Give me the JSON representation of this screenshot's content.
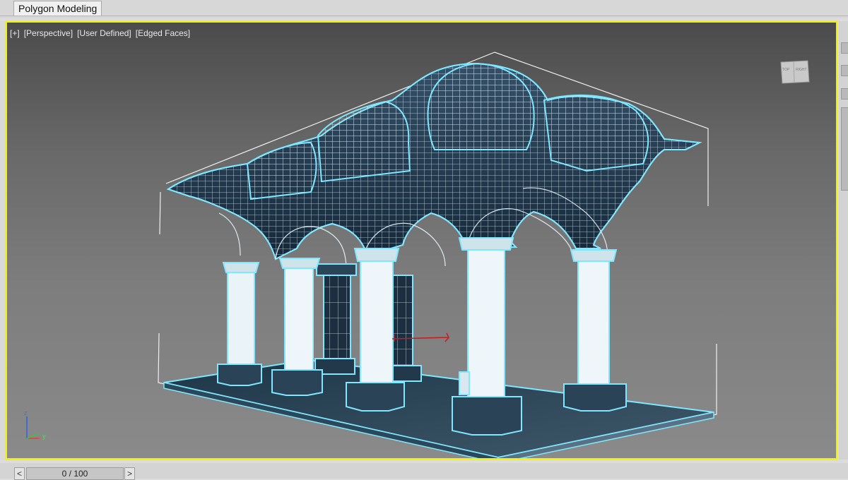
{
  "ribbon": {
    "tab_label": "Polygon Modeling"
  },
  "viewport": {
    "labels": [
      "[+]",
      "[Perspective]",
      "[User Defined]",
      "[Edged Faces]"
    ],
    "active_border_color": "#f2f200",
    "wire_color": "#7fe7ff",
    "viewcube_faces": [
      "TOP",
      "RIGHT"
    ],
    "axis_labels": {
      "z": "z",
      "x": "x",
      "y": "y"
    }
  },
  "timeline": {
    "prev_label": "<",
    "next_label": ">",
    "slider_text": "0 / 100"
  }
}
